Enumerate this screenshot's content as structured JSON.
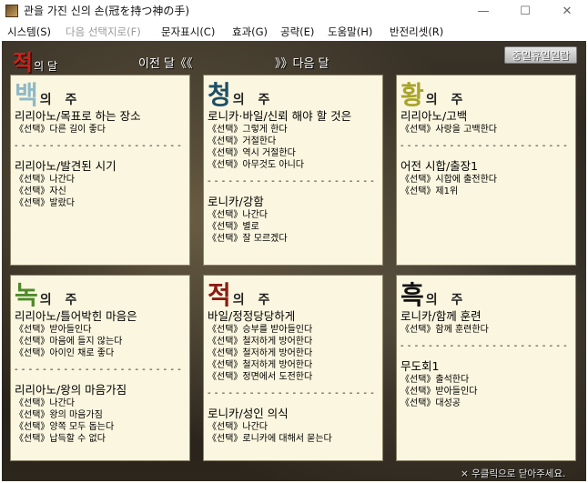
{
  "window": {
    "title": "관을 가진 신의 손(冠を持つ神の手)",
    "minimize": "—",
    "maximize": "☐",
    "close": "✕"
  },
  "menu": [
    {
      "label": "시스템(S)",
      "disabled": false
    },
    {
      "label": "다음 선택지로(F)",
      "disabled": true
    },
    {
      "label": "문자표시(C)",
      "disabled": false
    },
    {
      "label": "효과(G)",
      "disabled": false
    },
    {
      "label": "공략(E)",
      "disabled": false
    },
    {
      "label": "도움말(H)",
      "disabled": false
    },
    {
      "label": "반전리셋(R)",
      "disabled": false
    }
  ],
  "header": {
    "month_char": "적",
    "month_suffix": "의 달",
    "prev": "이전 달《《",
    "next": "》》다음 달",
    "mid_holiday": "중일휴일일람"
  },
  "weeks": [
    {
      "char": "백",
      "rest": "의 주",
      "color": "#8fb9c7",
      "events": [
        {
          "title": "리리아노/목표로 하는 장소",
          "choices": [
            "《선택》다른 길이 좋다"
          ]
        },
        {
          "title": "리리아노/발견된 시기",
          "choices": [
            "《선택》나간다",
            "《선택》자신",
            "《선택》발랐다"
          ]
        }
      ]
    },
    {
      "char": "청",
      "rest": "의 주",
      "color": "#1d4f66",
      "events": [
        {
          "title": "로니카·바일/신뢰 해야 할 것은",
          "choices": [
            "《선택》그렇게 한다",
            "《선택》거절한다",
            "《선택》역시 거절한다",
            "《선택》아무것도 아니다"
          ]
        },
        {
          "title": "로니카/강함",
          "choices": [
            "《선택》나간다",
            "《선택》별로",
            "《선택》잘 모르겠다"
          ]
        }
      ]
    },
    {
      "char": "황",
      "rest": "의 주",
      "color": "#a7a42c",
      "events": [
        {
          "title": "리리아노/고백",
          "choices": [
            "《선택》사랑을 고백한다"
          ]
        },
        {
          "title": "어전 시합/출장1",
          "choices": [
            "《선택》시합에 출전한다",
            "《선택》제1위"
          ]
        }
      ]
    },
    {
      "char": "녹",
      "rest": "의 주",
      "color": "#4d8a2a",
      "events": [
        {
          "title": "리리아노/틀어박힌 마음은",
          "choices": [
            "《선택》받아들인다",
            "《선택》마음에 들지 않는다",
            "《선택》아이인 채로 좋다"
          ]
        },
        {
          "title": "리리아노/왕의 마음가짐",
          "choices": [
            "《선택》나간다",
            "《선택》왕의 마음가짐",
            "《선택》양쪽 모두 돕는다",
            "《선택》납득할 수 없다"
          ]
        }
      ]
    },
    {
      "char": "적",
      "rest": "의 주",
      "color": "#8a1c14",
      "events": [
        {
          "title": "바일/정정당당하게",
          "choices": [
            "《선택》승부를 받아들인다",
            "《선택》철저하게 방어한다",
            "《선택》철저하게 방어한다",
            "《선택》철저하게 방어한다",
            "《선택》정면에서 도전한다"
          ]
        },
        {
          "title": "로니카/성인 의식",
          "choices": [
            "《선택》나간다",
            "《선택》로니카에 대해서 묻는다"
          ]
        }
      ]
    },
    {
      "char": "흑",
      "rest": "의 주",
      "color": "#111111",
      "events": [
        {
          "title": "로니카/함께 훈련",
          "choices": [
            "《선택》함께 훈련한다"
          ]
        },
        {
          "title": "무도회1",
          "choices": [
            "《선택》출석한다",
            "《선택》받아들인다",
            "《선택》대성공"
          ]
        }
      ]
    }
  ],
  "divider": "- - - - - - - - - - - - - - - - - - - - - - - -",
  "footer": "× 우클릭으로 닫아주세요."
}
